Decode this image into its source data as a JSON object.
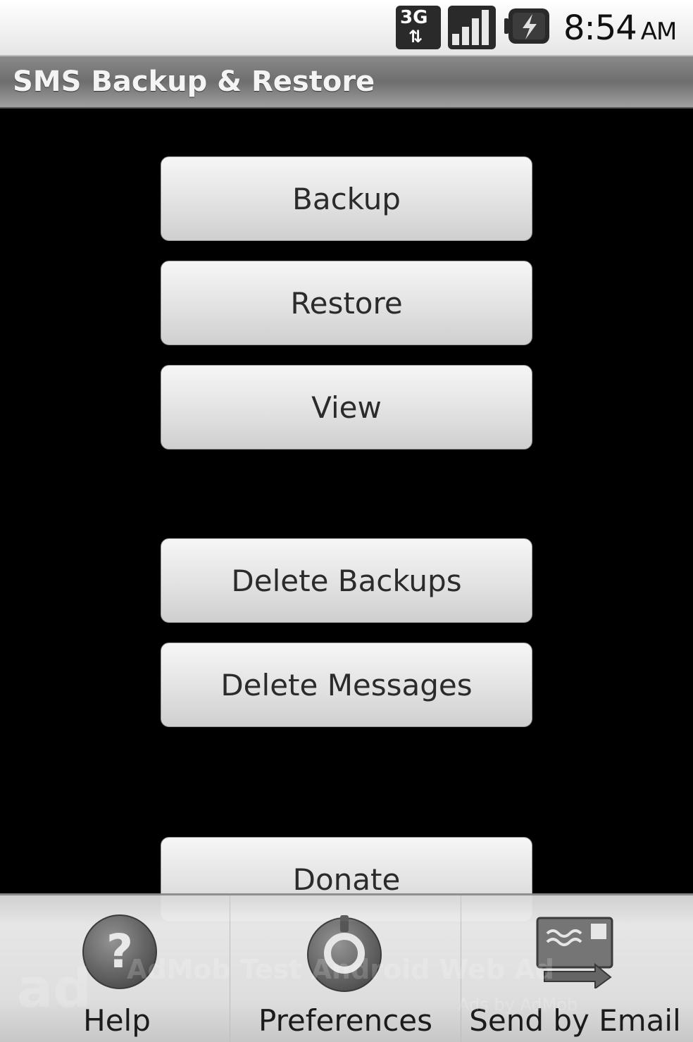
{
  "status_bar": {
    "network": "3G",
    "time": "8:54",
    "ampm": "AM",
    "icons": [
      "3g-data-icon",
      "signal-strength-icon",
      "battery-charging-icon"
    ]
  },
  "title_bar": {
    "title": "SMS Backup & Restore"
  },
  "buttons": {
    "backup": "Backup",
    "restore": "Restore",
    "view": "View",
    "delete_backups": "Delete Backups",
    "delete_messages": "Delete Messages",
    "donate": "Donate"
  },
  "ad_banner": {
    "text": "AdMob Test Android Web Ad",
    "sub": "Ads by AdMob"
  },
  "menu": {
    "items": [
      {
        "label": "Help",
        "icon": "help-icon"
      },
      {
        "label": "Preferences",
        "icon": "preferences-icon"
      },
      {
        "label": "Send by Email",
        "icon": "send-email-icon"
      }
    ]
  },
  "colors": {
    "background": "#000000",
    "title_bar": "#7a7a7a",
    "button_face": "#e2e2e2",
    "menu_background": "#e8e8e8"
  }
}
